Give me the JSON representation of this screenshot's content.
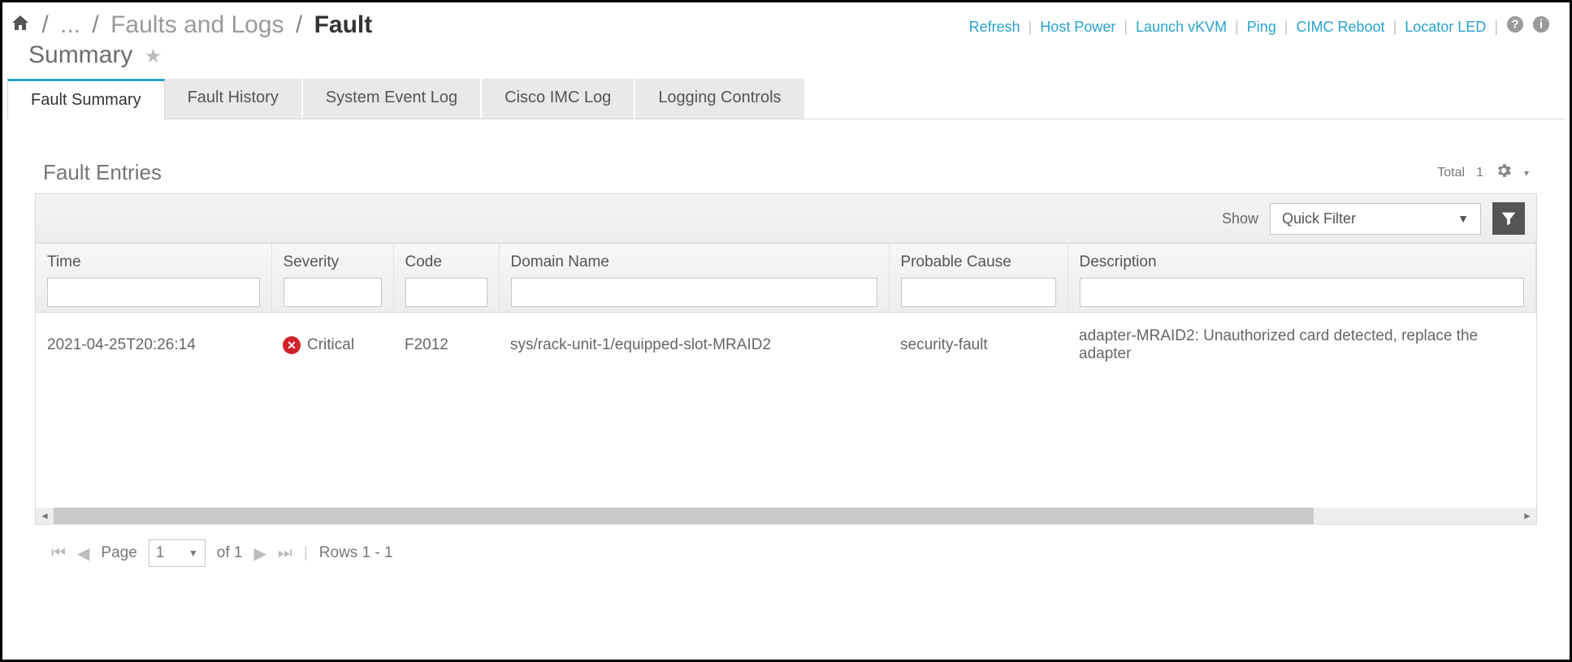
{
  "breadcrumb": {
    "ellipsis": "...",
    "parent": "Faults and Logs",
    "current_prefix": "Fault",
    "current_suffix": "Summary"
  },
  "toplinks": {
    "refresh": "Refresh",
    "host_power": "Host Power",
    "launch_vkvm": "Launch vKVM",
    "ping": "Ping",
    "cimc_reboot": "CIMC Reboot",
    "locator_led": "Locator LED"
  },
  "tabs": {
    "fault_summary": "Fault Summary",
    "fault_history": "Fault History",
    "system_event_log": "System Event Log",
    "cisco_imc_log": "Cisco IMC Log",
    "logging_controls": "Logging Controls"
  },
  "section": {
    "title": "Fault Entries",
    "total_label": "Total",
    "total_count": "1"
  },
  "filter": {
    "show_label": "Show",
    "selected": "Quick Filter"
  },
  "columns": {
    "time": "Time",
    "severity": "Severity",
    "code": "Code",
    "domain_name": "Domain Name",
    "probable_cause": "Probable Cause",
    "description": "Description"
  },
  "rows": [
    {
      "time": "2021-04-25T20:26:14",
      "severity": "Critical",
      "code": "F2012",
      "domain_name": "sys/rack-unit-1/equipped-slot-MRAID2",
      "probable_cause": "security-fault",
      "description": "adapter-MRAID2: Unauthorized card detected, replace the adapter"
    }
  ],
  "pager": {
    "page_label": "Page",
    "page_value": "1",
    "of_label": "of 1",
    "rows_label": "Rows 1 - 1"
  }
}
